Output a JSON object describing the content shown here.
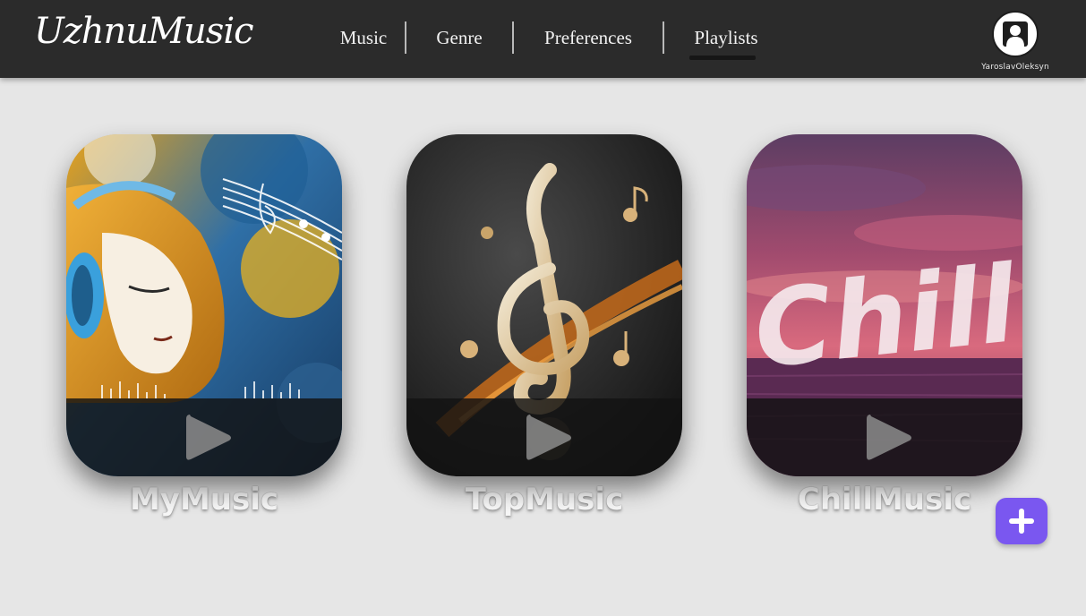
{
  "app": {
    "logo": "UzhnuMusic"
  },
  "nav": {
    "items": [
      {
        "label": "Music"
      },
      {
        "label": "Genre"
      },
      {
        "label": "Preferences"
      },
      {
        "label": "Playlists",
        "active": true
      }
    ]
  },
  "profile": {
    "username": "YaroslavOleksyn",
    "icon": "user-portrait-icon"
  },
  "playlists": [
    {
      "title": "MyMusic",
      "cover": "girl-with-headphones-art",
      "action_icon": "play-icon"
    },
    {
      "title": "TopMusic",
      "cover": "treble-clef-art",
      "action_icon": "play-icon"
    },
    {
      "title": "ChillMusic",
      "cover": "chill-sunset-sea-art",
      "cover_text": "Chill",
      "action_icon": "play-icon"
    }
  ],
  "add_playlist": {
    "icon": "plus-icon"
  },
  "colors": {
    "header": "#2b2b2b",
    "background": "#e6e6e6",
    "accent": "#7a57f0"
  }
}
